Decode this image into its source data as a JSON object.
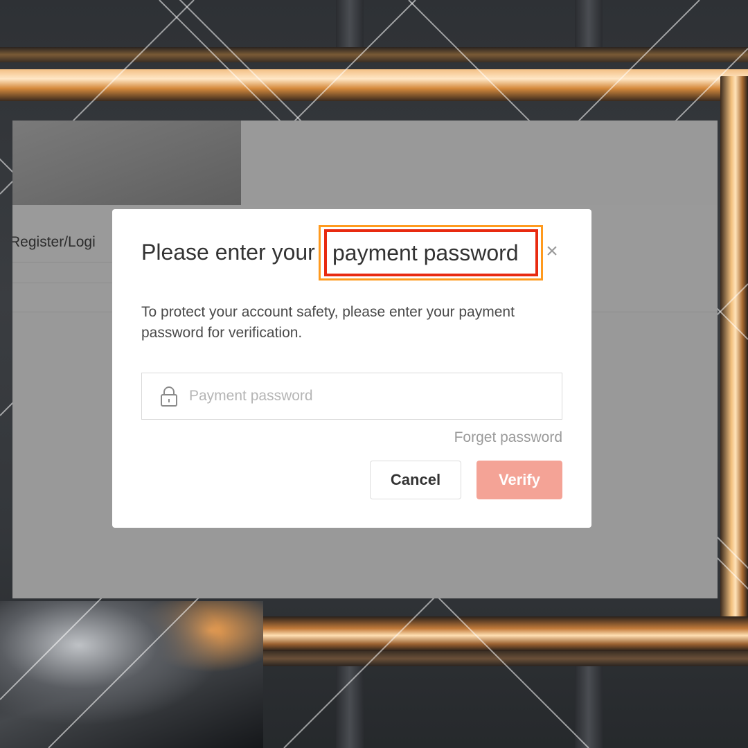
{
  "background": {
    "frame_glow_color": "#ffd9a8",
    "wall_color": "#3a3d41"
  },
  "page_behind": {
    "register_login_label": "Register/Logi"
  },
  "modal": {
    "title_prefix": "Please enter your",
    "title_highlight": "payment password",
    "highlight_colors": {
      "outer": "#ff9a1e",
      "inner": "#e82a10"
    },
    "close_icon": "close-icon",
    "description": "To protect your account safety, please enter your payment password for verification.",
    "password_field": {
      "placeholder": "Payment password",
      "value": "",
      "icon": "lock-icon"
    },
    "forget_password_label": "Forget password",
    "cancel_label": "Cancel",
    "verify_label": "Verify",
    "verify_color": "#f4a396"
  }
}
